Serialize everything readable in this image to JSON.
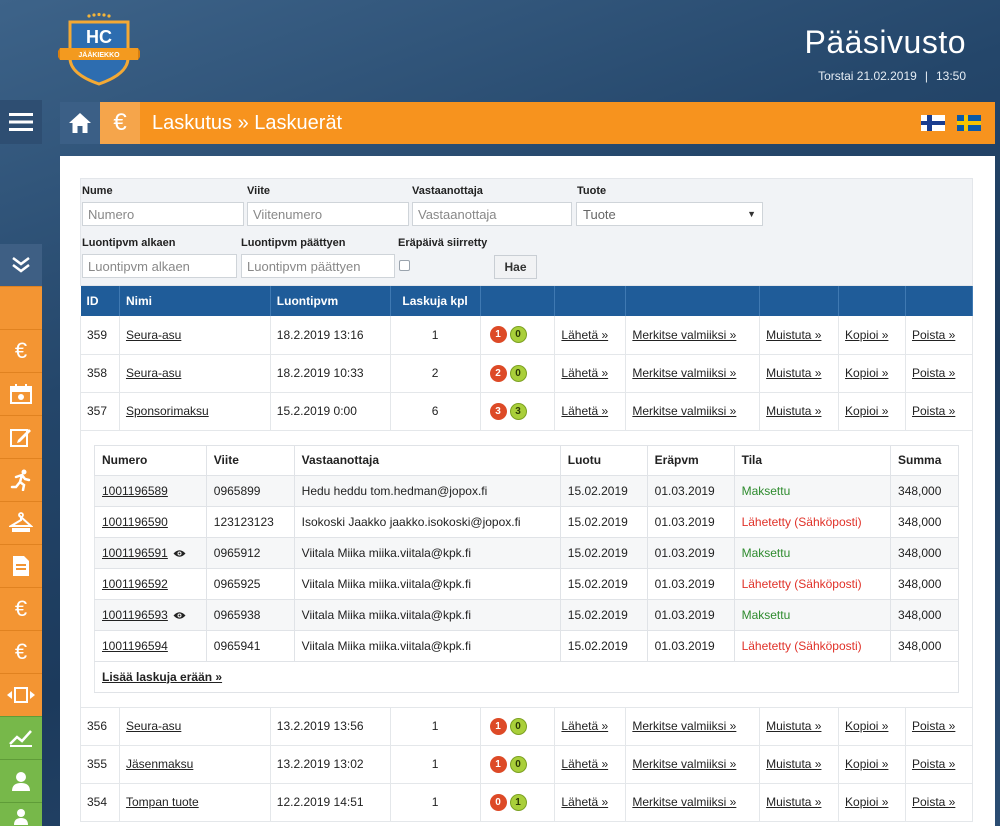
{
  "header": {
    "logo_text": "HC",
    "logo_sub": "JÄÄKIEKKO",
    "site_title": "Pääsivusto",
    "date": "Torstai 21.02.2019",
    "separator": "|",
    "time": "13:50"
  },
  "titlebar": {
    "title": "Laskutus » Laskuerät",
    "euro_icon": "€"
  },
  "filters": {
    "nume_label": "Nume",
    "nume_placeholder": "Numero",
    "viite_label": "Viite",
    "viite_placeholder": "Viitenumero",
    "vastaanottaja_label": "Vastaanottaja",
    "vastaanottaja_placeholder": "Vastaanottaja",
    "tuote_label": "Tuote",
    "tuote_selected": "Tuote",
    "alkaen_label": "Luontipvm alkaen",
    "alkaen_placeholder": "Luontipvm alkaen",
    "paattyen_label": "Luontipvm päättyen",
    "paattyen_placeholder": "Luontipvm päättyen",
    "erapaiva_label": "Eräpäivä siirretty",
    "search_button": "Hae"
  },
  "table": {
    "headers": {
      "id": "ID",
      "nimi": "Nimi",
      "luontipvm": "Luontipvm",
      "laskuja": "Laskuja kpl"
    },
    "actions": {
      "laheta": "Lähetä »",
      "merkitse": "Merkitse valmiiksi »",
      "muistuta": "Muistuta »",
      "kopioi": "Kopioi »",
      "poista": "Poista »"
    },
    "rows": [
      {
        "id": "359",
        "nimi": "Seura-asu",
        "date": "18.2.2019 13:16",
        "count": "1",
        "red": "1",
        "green": "0"
      },
      {
        "id": "358",
        "nimi": "Seura-asu",
        "date": "18.2.2019 10:33",
        "count": "2",
        "red": "2",
        "green": "0"
      },
      {
        "id": "357",
        "nimi": "Sponsorimaksu",
        "date": "15.2.2019 0:00",
        "count": "6",
        "red": "3",
        "green": "3"
      },
      {
        "id": "356",
        "nimi": "Seura-asu",
        "date": "13.2.2019 13:56",
        "count": "1",
        "red": "1",
        "green": "0"
      },
      {
        "id": "355",
        "nimi": "Jäsenmaksu",
        "date": "13.2.2019 13:02",
        "count": "1",
        "red": "1",
        "green": "0"
      },
      {
        "id": "354",
        "nimi": "Tompan tuote",
        "date": "12.2.2019 14:51",
        "count": "1",
        "red": "0",
        "green": "1"
      }
    ]
  },
  "invoices": {
    "headers": {
      "numero": "Numero",
      "viite": "Viite",
      "vastaanottaja": "Vastaanottaja",
      "luotu": "Luotu",
      "erapvm": "Eräpvm",
      "tila": "Tila",
      "summa": "Summa"
    },
    "rows": [
      {
        "numero": "1001196589",
        "viite": "0965899",
        "vastaanottaja": "Hedu heddu tom.hedman@jopox.fi",
        "luotu": "15.02.2019",
        "erapvm": "01.03.2019",
        "tila": "Maksettu",
        "summa": "348,000"
      },
      {
        "numero": "1001196590",
        "viite": "123123123",
        "vastaanottaja": "Isokoski Jaakko jaakko.isokoski@jopox.fi",
        "luotu": "15.02.2019",
        "erapvm": "01.03.2019",
        "tila": "Lähetetty (Sähköposti)",
        "summa": "348,000"
      },
      {
        "numero": "1001196591",
        "viite": "0965912",
        "vastaanottaja": "Viitala Miika miika.viitala@kpk.fi",
        "luotu": "15.02.2019",
        "erapvm": "01.03.2019",
        "tila": "Maksettu",
        "summa": "348,000"
      },
      {
        "numero": "1001196592",
        "viite": "0965925",
        "vastaanottaja": "Viitala Miika miika.viitala@kpk.fi",
        "luotu": "15.02.2019",
        "erapvm": "01.03.2019",
        "tila": "Lähetetty (Sähköposti)",
        "summa": "348,000"
      },
      {
        "numero": "1001196593",
        "viite": "0965938",
        "vastaanottaja": "Viitala Miika miika.viitala@kpk.fi",
        "luotu": "15.02.2019",
        "erapvm": "01.03.2019",
        "tila": "Maksettu",
        "summa": "348,000"
      },
      {
        "numero": "1001196594",
        "viite": "0965941",
        "vastaanottaja": "Viitala Miika miika.viitala@kpk.fi",
        "luotu": "15.02.2019",
        "erapvm": "01.03.2019",
        "tila": "Lähetetty (Sähköposti)",
        "summa": "348,000"
      }
    ],
    "add_more": "Lisää laskuja erään »"
  },
  "colors": {
    "orange": "#f7931e",
    "navy": "#1f5c99",
    "paid": "#2e8b2e",
    "sent": "#e03128"
  }
}
